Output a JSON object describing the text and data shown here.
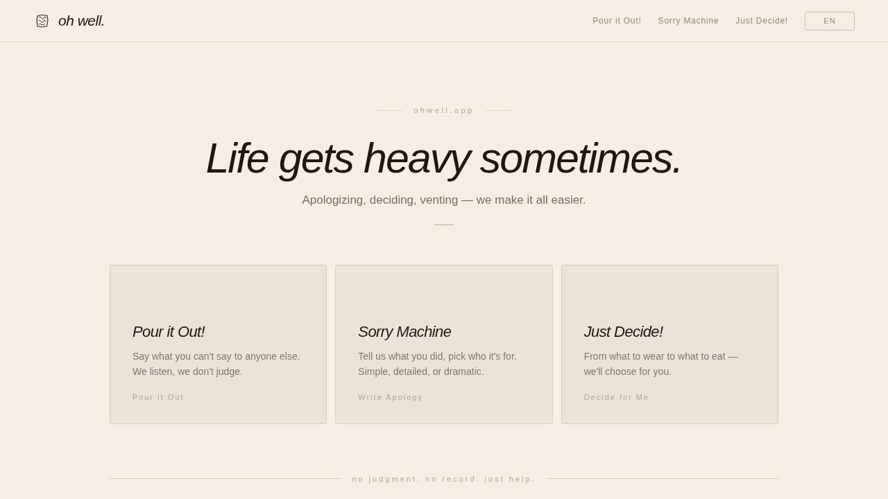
{
  "header": {
    "brand": "oh well.",
    "nav": [
      "Pour it Out!",
      "Sorry Machine",
      "Just Decide!"
    ],
    "language_button": "EN"
  },
  "hero": {
    "eyebrow": "ohwell.app",
    "title": "Life gets heavy sometimes.",
    "subtitle": "Apologizing, deciding, venting — we make it all easier."
  },
  "cards": [
    {
      "title": "Pour it Out!",
      "description_lines": [
        "Say what you can't say to anyone else.",
        "We listen, we don't judge."
      ],
      "link": "Pour it Out"
    },
    {
      "title": "Sorry Machine",
      "description_lines": [
        "Tell us what you did, pick who it's for.",
        "Simple, detailed, or dramatic."
      ],
      "link": "Write Apology"
    },
    {
      "title": "Just Decide!",
      "description_lines": [
        "From what to wear to what to eat —",
        "we'll choose for you."
      ],
      "link": "Decide for Me"
    }
  ],
  "footer": {
    "tagline": "no judgment. no record. just help."
  }
}
